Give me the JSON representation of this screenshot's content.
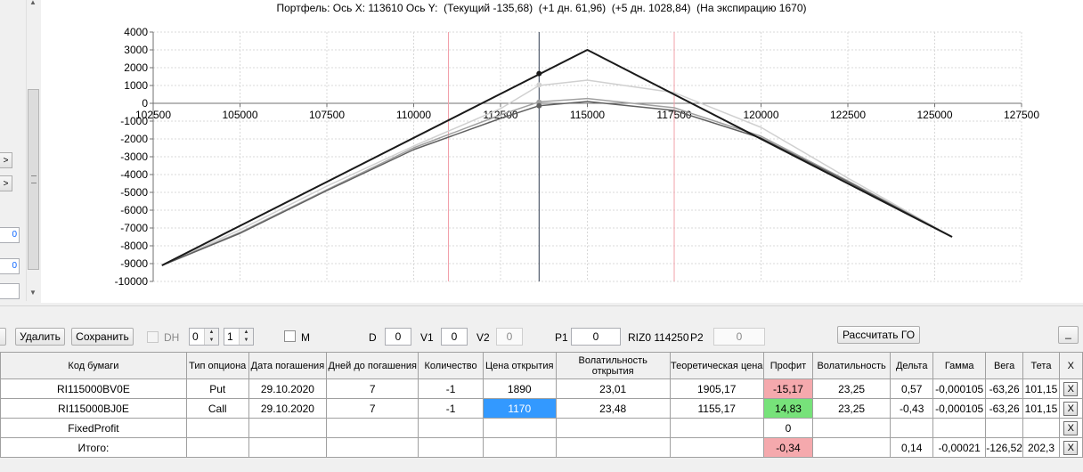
{
  "title_bar": "Портфель: Ось X: 113610 Ось Y:  (Текущий -135,68)  (+1 дн. 61,96)  (+5 дн. 1028,84)  (На экспирацию 1670)",
  "left_panel": {
    "buttons": [
      ">",
      ">"
    ],
    "fields": [
      "0",
      "0"
    ]
  },
  "chart_data": {
    "type": "line",
    "xlim": [
      102500,
      127500
    ],
    "ylim": [
      -10000,
      4000
    ],
    "x_ticks": [
      "102500",
      "105000",
      "107500",
      "110000",
      "112500",
      "115000",
      "117500",
      "120000",
      "122500",
      "125000",
      "127500"
    ],
    "y_ticks": [
      "4000",
      "3000",
      "2000",
      "1000",
      "0",
      "-1000",
      "-2000",
      "-3000",
      "-4000",
      "-5000",
      "-6000",
      "-7000",
      "-8000",
      "-9000",
      "-10000"
    ],
    "grid": true,
    "vertical_markers": [
      {
        "x": 111000,
        "color": "#f2a0aa"
      },
      {
        "x": 113610,
        "color": "#303c50"
      },
      {
        "x": 117500,
        "color": "#f2a0aa"
      }
    ],
    "series": [
      {
        "color": "#1a1a1a",
        "x": [
          102750,
          115000,
          125500
        ],
        "y": [
          -9100,
          3000,
          -7500
        ]
      },
      {
        "color": "#d0d0d0",
        "x": [
          102750,
          105000,
          107500,
          110000,
          112500,
          113610,
          115000,
          117500,
          120000,
          122500,
          125500
        ],
        "y": [
          -9100,
          -7100,
          -4650,
          -2400,
          -300,
          1000,
          1300,
          600,
          -1350,
          -4200,
          -7500
        ]
      },
      {
        "color": "#a0a0a0",
        "x": [
          102750,
          105000,
          107500,
          110000,
          112500,
          113610,
          115000,
          117500,
          120000,
          122500,
          125500
        ],
        "y": [
          -9100,
          -7250,
          -4850,
          -2500,
          -650,
          80,
          270,
          -250,
          -1850,
          -4350,
          -7500
        ]
      },
      {
        "color": "#606060",
        "x": [
          102750,
          105000,
          107500,
          110000,
          112500,
          113610,
          115000,
          117500,
          120000,
          122500,
          125500
        ],
        "y": [
          -9100,
          -7300,
          -4900,
          -2600,
          -850,
          -136,
          100,
          -400,
          -1950,
          -4400,
          -7500
        ]
      }
    ],
    "points": [
      {
        "x": 113610,
        "y": 1670,
        "color": "#1a1a1a"
      },
      {
        "x": 113610,
        "y": 1029,
        "color": "#d0d0d0"
      },
      {
        "x": 113610,
        "y": 62,
        "color": "#a0a0a0"
      },
      {
        "x": 113610,
        "y": -136,
        "color": "#606060"
      }
    ]
  },
  "toolbar": {
    "delete": "Удалить",
    "save": "Сохранить",
    "dh": "DH",
    "spin1": "0",
    "spin2": "1",
    "m": "M",
    "d_label": "D",
    "d_value": "0",
    "v1_label": "V1",
    "v1_value": "0",
    "v2_label": "V2",
    "v2_value": "0",
    "p1_label": "P1",
    "p1_value": "0",
    "riz_text": "RIZ0 114250",
    "p2_label": "P2",
    "p2_value": "0",
    "calc_go": "Рассчитать ГО",
    "minimize": "_"
  },
  "grid": {
    "headers": [
      "Код бумаги",
      "Тип опциона",
      "Дата погашения",
      "Дней до погашения",
      "Количество",
      "Цена открытия",
      "Волатильность открытия",
      "Теоретическая цена",
      "Профит",
      "Волатильность",
      "Дельта",
      "Гамма",
      "Вега",
      "Тета",
      "X"
    ],
    "rows": [
      [
        "RI115000BV0E",
        "Put",
        "29.10.2020",
        "7",
        "-1",
        "1890",
        "23,01",
        "1905,17",
        "-15,17",
        "23,25",
        "0,57",
        "-0,000105",
        "-63,26",
        "101,15",
        "X"
      ],
      [
        "RI115000BJ0E",
        "Call",
        "29.10.2020",
        "7",
        "-1",
        "1170",
        "23,48",
        "1155,17",
        "14,83",
        "23,25",
        "-0,43",
        "-0,000105",
        "-63,26",
        "101,15",
        "X"
      ],
      [
        "FixedProfit",
        "",
        "",
        "",
        "",
        "",
        "",
        "",
        "0",
        "",
        "",
        "",
        "",
        "",
        "X"
      ],
      [
        "Итого:",
        "",
        "",
        "",
        "",
        "",
        "",
        "",
        "-0,34",
        "",
        "0,14",
        "-0,00021",
        "-126,52",
        "202,3",
        "X"
      ]
    ]
  }
}
